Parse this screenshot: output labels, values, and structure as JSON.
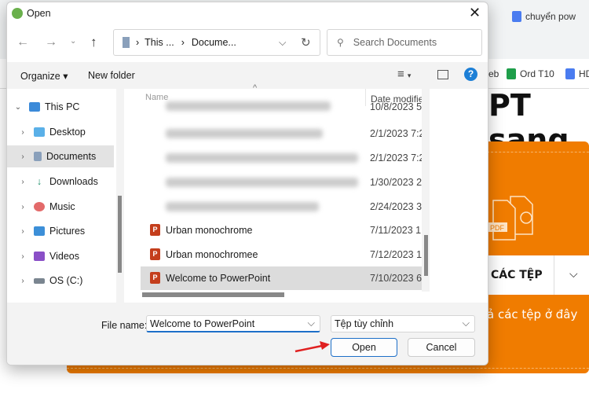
{
  "background": {
    "tabs": [
      {
        "label": "chuyển pow"
      }
    ],
    "bookmarks": [
      {
        "label": "eb"
      },
      {
        "label": "Ord T10"
      },
      {
        "label": "HD"
      }
    ],
    "heading": "PT sang",
    "choose_button": "CÁC TỆP",
    "drop_text": "ả các tệp ở đây",
    "pdf_badge": "PDF",
    "accent": "#f07c00"
  },
  "dialog": {
    "title": "Open",
    "breadcrumb": [
      "This ...",
      "Docume..."
    ],
    "search_placeholder": "Search Documents",
    "toolbar": {
      "organize": "Organize",
      "new_folder": "New folder"
    },
    "nav": [
      {
        "label": "This PC",
        "expanded": true,
        "icon": "pc-icon"
      },
      {
        "label": "Desktop",
        "icon": "desktop-icon"
      },
      {
        "label": "Documents",
        "selected": true,
        "icon": "documents-icon"
      },
      {
        "label": "Downloads",
        "icon": "downloads-icon"
      },
      {
        "label": "Music",
        "icon": "music-icon"
      },
      {
        "label": "Pictures",
        "icon": "pictures-icon"
      },
      {
        "label": "Videos",
        "icon": "videos-icon"
      },
      {
        "label": "OS (C:)",
        "icon": "drive-icon"
      }
    ],
    "columns": {
      "name": "Name",
      "date": "Date modified"
    },
    "files": [
      {
        "name": "",
        "date": "10/8/2023 5"
      },
      {
        "name": "",
        "date": "2/1/2023 7:2"
      },
      {
        "name": "",
        "date": "2/1/2023 7:2"
      },
      {
        "name": "",
        "date": "1/30/2023 2"
      },
      {
        "name": "",
        "date": "2/24/2023 3"
      },
      {
        "name": "Urban monochrome",
        "date": "7/11/2023 1"
      },
      {
        "name": "Urban monochromee",
        "date": "7/12/2023 1"
      },
      {
        "name": "Welcome to PowerPoint",
        "date": "7/10/2023 6",
        "selected": true
      }
    ],
    "file_name_label": "File name:",
    "file_name_value": "Welcome to PowerPoint",
    "file_type": "Tệp tùy chỉnh",
    "open_button": "Open",
    "cancel_button": "Cancel"
  }
}
